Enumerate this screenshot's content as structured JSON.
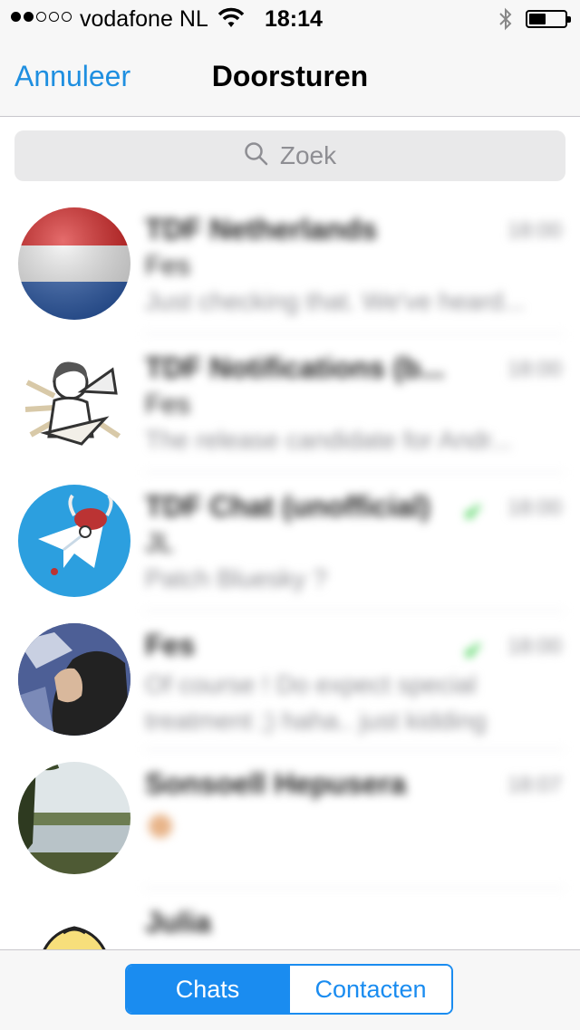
{
  "status_bar": {
    "carrier": "vodafone NL",
    "time": "18:14",
    "signal_strength_dots": 2
  },
  "nav": {
    "cancel_label": "Annuleer",
    "title": "Doorsturen"
  },
  "search": {
    "placeholder": "Zoek"
  },
  "chats": [
    {
      "name": "TDF Netherlands",
      "sender": "Fes",
      "preview": "Just checking that. We've heard...",
      "time": "18:00",
      "read": false
    },
    {
      "name": "TDF Notifications (b...",
      "sender": "Fes",
      "preview": "The release candidate for Andr...",
      "time": "18:00",
      "read": false
    },
    {
      "name": "TDF Chat (unofficial)",
      "sender": "JL",
      "preview": "Patch Bluesky ?",
      "time": "18:00",
      "read": true
    },
    {
      "name": "Fes",
      "sender": "",
      "preview": "Of course ! Do expect special treatment ;) haha.. just kidding",
      "time": "18:00",
      "read": true
    },
    {
      "name": "Sonsoell Hepusera",
      "sender": "",
      "preview": "",
      "time": "18:07",
      "read": false
    },
    {
      "name": "Julia",
      "sender": "",
      "preview": "",
      "time": "",
      "read": false
    }
  ],
  "tabs": {
    "chats_label": "Chats",
    "contacts_label": "Contacten",
    "active": "Chats"
  },
  "colors": {
    "accent": "#1a8cf0",
    "check": "#2ecc40"
  }
}
